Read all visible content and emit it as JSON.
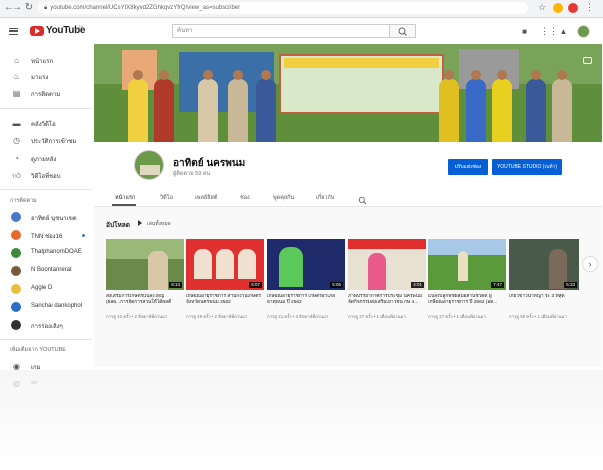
{
  "browser": {
    "url": "youtube.com/channel/UCsYtX8kyvd2ZGhkqvzYfrQ/view_as=subscriber"
  },
  "header": {
    "logo_text": "YouTube",
    "logo_sup": "TH",
    "search_placeholder": "ค้นหา"
  },
  "sidebar": {
    "main_items": [
      {
        "label": "หน้าแรก",
        "icon": "home-icon"
      },
      {
        "label": "มาแรง",
        "icon": "trending-icon"
      },
      {
        "label": "การติดตาม",
        "icon": "subscriptions-icon"
      }
    ],
    "library_items": [
      {
        "label": "คลังวิดีโอ",
        "icon": "library-icon"
      },
      {
        "label": "ประวัติการเข้าชม",
        "icon": "history-icon"
      },
      {
        "label": "ดูภายหลัง",
        "icon": "watch-later-icon"
      },
      {
        "label": "วิดีโอที่ชอบ",
        "icon": "like-icon"
      }
    ],
    "subs_heading": "การติดตาม",
    "subscriptions": [
      {
        "label": "อาทิตย์ นุชนาเขต",
        "color": "#4a78c8"
      },
      {
        "label": "TNN ช่อง16",
        "color": "#e8692a"
      },
      {
        "label": "ThatphanomDOAE",
        "color": "#3d8a3d"
      },
      {
        "label": "N Boontanrerat",
        "color": "#7a5a3a"
      },
      {
        "label": "Aggie D",
        "color": "#e6c23a"
      },
      {
        "label": "Sanchai dankophol",
        "color": "#2a6ec8"
      },
      {
        "label": "การร่องเลิงๆ",
        "color": "#333333"
      }
    ],
    "more_heading": "เพิ่มเติมจาก YOUTUBE",
    "more_items": [
      {
        "label": "เกม"
      },
      {
        "label": "สด"
      }
    ]
  },
  "channel": {
    "name": "อาทิตย์ นครพนม",
    "subscribers": "ผู้ติดตาม 59 คน",
    "customize_label": "ปรับแต่งช่อง",
    "studio_label": "YOUTUBE STUDIO (เบต้า)"
  },
  "tabs": [
    "หน้าแรก",
    "วิดีโอ",
    "เพลย์ลิสต์",
    "ช่อง",
    "พูดคุยกัน",
    "เกี่ยวกับ"
  ],
  "section": {
    "title": "อัปโหลด",
    "play_all": "เล่นทั้งหมด"
  },
  "videos": [
    {
      "title": "ส่งเสริมการเกษตรแปลงใหญ่ (ผลผ...การจัดการสวนให้ได้ผลดี",
      "meta": "การดู 42 ครั้ง • 2 สัปดาห์ที่ผ่านมา",
      "duration": "8:13"
    },
    {
      "title": "เกษียณอายุราชการ สำนักงานเกษตรจังหวัดนครพนม 2562",
      "meta": "การดู 49 ครั้ง • 2 สัปดาห์ที่ผ่านมา",
      "duration": "5:07"
    },
    {
      "title": "เกษียณอายุราชการ เกษตรอำเภอธาตุพนม ปี 2562",
      "meta": "การดู 21 ครั้ง • 3 สัปดาห์ที่ผ่านมา",
      "duration": "5:05"
    },
    {
      "title": "ภาพบรรยากาศการประชุม นครพนม จัดกิจกรรมส่งเสริมเยาวชน กษ 4...",
      "meta": "การดู 37 ครั้ง • 1 เดือนที่ผ่านมา",
      "duration": "4:01"
    },
    {
      "title": "แปลงปลูกพืชผสมผสานชีวิตดี ผู้เกษียณอายุราชการ ปี 2562 (อด...",
      "meta": "การดู 27 ครั้ง • 1 เดือนที่ผ่านมา",
      "duration": "7:47"
    },
    {
      "title": "เกี่ยวข้าวนาหญ้า ระ 3 ที่สุด",
      "meta": "การดู 59 ครั้ง • 1 เดือนที่ผ่านมา",
      "duration": "5:33"
    }
  ]
}
